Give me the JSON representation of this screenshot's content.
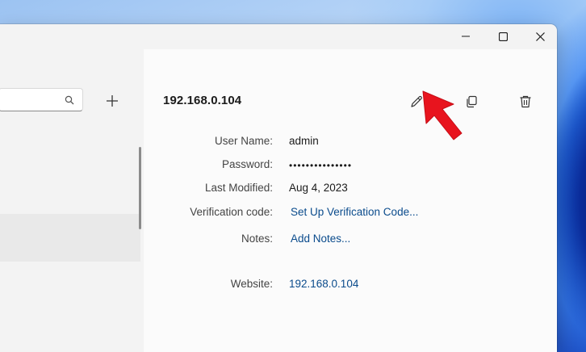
{
  "window": {
    "caption": {
      "minimize_icon": "minimize-icon",
      "maximize_icon": "maximize-icon",
      "close_icon": "close-icon"
    }
  },
  "sidebar": {
    "search_icon": "search-icon",
    "add_icon": "plus-icon"
  },
  "entry": {
    "title": "192.168.0.104",
    "toolbar": {
      "edit_icon": "pencil-icon",
      "copy_icon": "copy-icon",
      "delete_icon": "trash-icon"
    },
    "fields": {
      "username_label": "User Name:",
      "username_value": "admin",
      "password_label": "Password:",
      "password_value": "•••••••••••••••",
      "modified_label": "Last Modified:",
      "modified_value": "Aug 4, 2023",
      "verification_label": "Verification code:",
      "verification_link": "Set Up Verification Code...",
      "notes_label": "Notes:",
      "notes_link": "Add Notes...",
      "website_label": "Website:",
      "website_value": "192.168.0.104"
    }
  },
  "colors": {
    "accent_link": "#0a4b8c",
    "cursor_arrow": "#e8141e"
  }
}
